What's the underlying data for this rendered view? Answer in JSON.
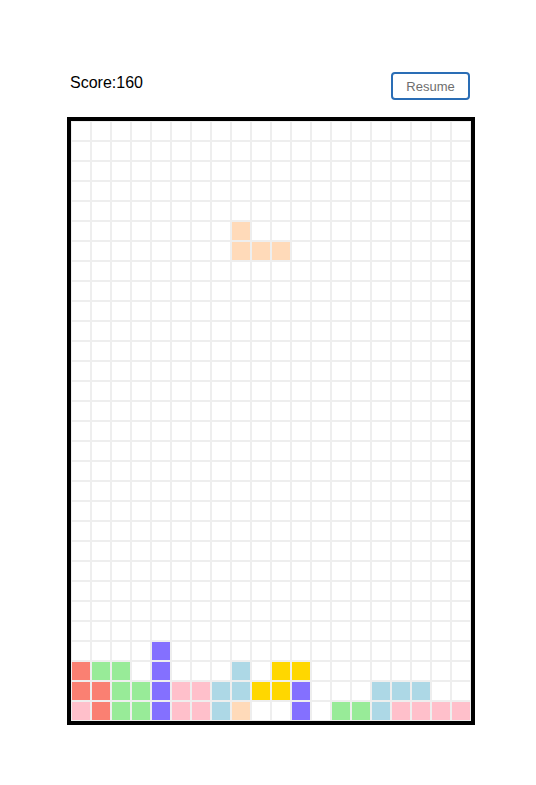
{
  "score": {
    "text": "Score:160"
  },
  "button": {
    "label": "Resume"
  },
  "board": {
    "rows": 30,
    "cols": 20,
    "cells": [
      {
        "row": 5,
        "col": 8,
        "color": "#ffdab9",
        "falling": true
      },
      {
        "row": 6,
        "col": 8,
        "color": "#ffdab9",
        "falling": true
      },
      {
        "row": 6,
        "col": 9,
        "color": "#ffdab9",
        "falling": true
      },
      {
        "row": 6,
        "col": 10,
        "color": "#ffdab9",
        "falling": true
      },
      {
        "row": 26,
        "col": 4,
        "color": "#8470ff",
        "falling": false
      },
      {
        "row": 27,
        "col": 0,
        "color": "#fa8072",
        "falling": false
      },
      {
        "row": 27,
        "col": 1,
        "color": "#98eb98",
        "falling": false
      },
      {
        "row": 27,
        "col": 2,
        "color": "#98eb98",
        "falling": false
      },
      {
        "row": 27,
        "col": 4,
        "color": "#8470ff",
        "falling": false
      },
      {
        "row": 27,
        "col": 8,
        "color": "#add8e6",
        "falling": false
      },
      {
        "row": 27,
        "col": 10,
        "color": "#ffd700",
        "falling": false
      },
      {
        "row": 27,
        "col": 11,
        "color": "#ffd700",
        "falling": false
      },
      {
        "row": 28,
        "col": 0,
        "color": "#fa8072",
        "falling": false
      },
      {
        "row": 28,
        "col": 1,
        "color": "#fa8072",
        "falling": false
      },
      {
        "row": 28,
        "col": 2,
        "color": "#98eb98",
        "falling": false
      },
      {
        "row": 28,
        "col": 3,
        "color": "#98eb98",
        "falling": false
      },
      {
        "row": 28,
        "col": 4,
        "color": "#8470ff",
        "falling": false
      },
      {
        "row": 28,
        "col": 5,
        "color": "#ffc0cb",
        "falling": false
      },
      {
        "row": 28,
        "col": 6,
        "color": "#ffc0cb",
        "falling": false
      },
      {
        "row": 28,
        "col": 7,
        "color": "#add8e6",
        "falling": false
      },
      {
        "row": 28,
        "col": 8,
        "color": "#add8e6",
        "falling": false
      },
      {
        "row": 28,
        "col": 9,
        "color": "#ffd700",
        "falling": false
      },
      {
        "row": 28,
        "col": 10,
        "color": "#ffd700",
        "falling": false
      },
      {
        "row": 28,
        "col": 11,
        "color": "#8470ff",
        "falling": false
      },
      {
        "row": 28,
        "col": 15,
        "color": "#add8e6",
        "falling": false
      },
      {
        "row": 28,
        "col": 16,
        "color": "#add8e6",
        "falling": false
      },
      {
        "row": 28,
        "col": 17,
        "color": "#add8e6",
        "falling": false
      },
      {
        "row": 29,
        "col": 0,
        "color": "#ffc0cb",
        "falling": false
      },
      {
        "row": 29,
        "col": 1,
        "color": "#fa8072",
        "falling": false
      },
      {
        "row": 29,
        "col": 2,
        "color": "#98eb98",
        "falling": false
      },
      {
        "row": 29,
        "col": 3,
        "color": "#98eb98",
        "falling": false
      },
      {
        "row": 29,
        "col": 4,
        "color": "#8470ff",
        "falling": false
      },
      {
        "row": 29,
        "col": 5,
        "color": "#ffc0cb",
        "falling": false
      },
      {
        "row": 29,
        "col": 6,
        "color": "#ffc0cb",
        "falling": false
      },
      {
        "row": 29,
        "col": 7,
        "color": "#add8e6",
        "falling": false
      },
      {
        "row": 29,
        "col": 8,
        "color": "#ffdab9",
        "falling": false
      },
      {
        "row": 29,
        "col": 11,
        "color": "#8470ff",
        "falling": false
      },
      {
        "row": 29,
        "col": 13,
        "color": "#98eb98",
        "falling": false
      },
      {
        "row": 29,
        "col": 14,
        "color": "#98eb98",
        "falling": false
      },
      {
        "row": 29,
        "col": 15,
        "color": "#add8e6",
        "falling": false
      },
      {
        "row": 29,
        "col": 16,
        "color": "#ffc0cb",
        "falling": false
      },
      {
        "row": 29,
        "col": 17,
        "color": "#ffc0cb",
        "falling": false
      },
      {
        "row": 29,
        "col": 18,
        "color": "#ffc0cb",
        "falling": false
      },
      {
        "row": 29,
        "col": 19,
        "color": "#ffc0cb",
        "falling": false
      }
    ]
  }
}
